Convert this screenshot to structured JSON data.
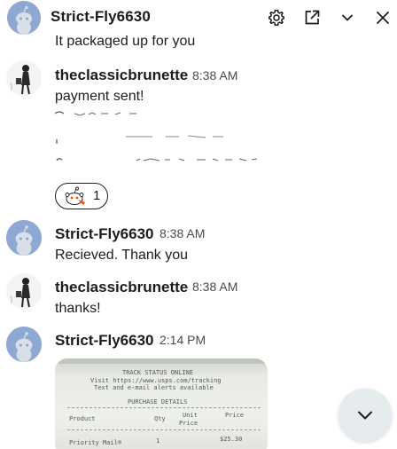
{
  "header": {
    "title": "Strict-Fly6630",
    "icons": [
      "settings-gear-icon",
      "open-external-icon",
      "chevron-down-icon",
      "close-icon"
    ]
  },
  "partial_message": {
    "text": "It packaged up for you"
  },
  "messages": [
    {
      "author": "theclassicbrunette",
      "time": "8:38 AM",
      "text": "payment sent!",
      "reaction": {
        "icon": "snoo-reaction-icon",
        "count": "1"
      }
    },
    {
      "author": "Strict-Fly6630",
      "time": "8:38 AM",
      "text": "Recieved. Thank you"
    },
    {
      "author": "theclassicbrunette",
      "time": "8:38 AM",
      "text": "thanks!"
    },
    {
      "author": "Strict-Fly6630",
      "time": "2:14 PM",
      "image": {
        "lines": [
          "TRACK STATUS ONLINE",
          "Visit https://www.usps.com/tracking",
          "Text and e-mail alerts available",
          "PURCHASE DETAILS",
          "Product",
          "Qty",
          "Unit",
          "Price",
          "Price",
          "Priority Mail®",
          "1",
          "$25.30"
        ]
      }
    }
  ],
  "scroll_button": {
    "icon": "chevron-down-icon"
  },
  "colors": {
    "snoo_avatar_bg": "#8da8d2",
    "text": "#1c1c1c",
    "time": "#4a4a4a"
  }
}
